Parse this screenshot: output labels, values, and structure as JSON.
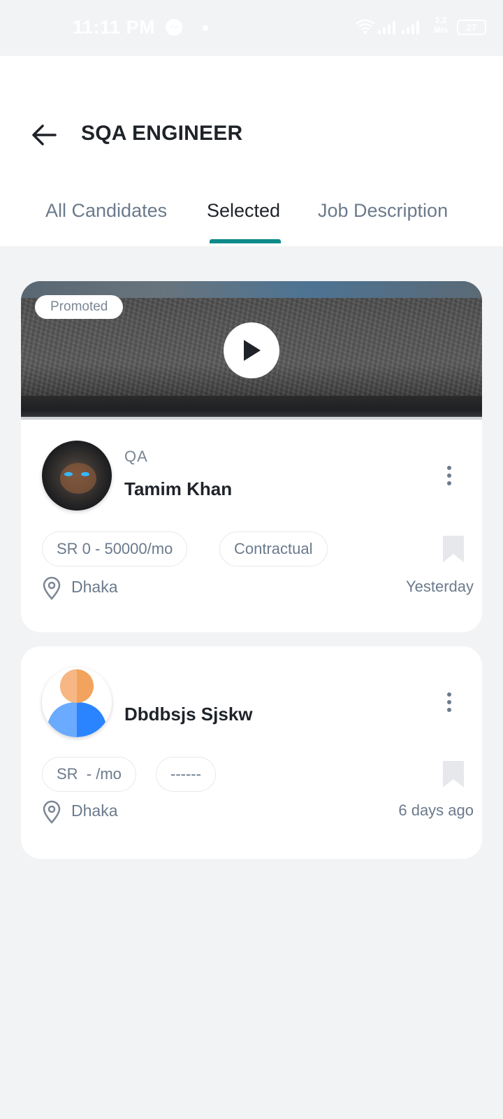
{
  "status_bar": {
    "time": "11:11 PM",
    "speed_top": "2.2",
    "speed_unit": "M/s",
    "battery": "27"
  },
  "header": {
    "title": "SQA ENGINEER"
  },
  "tabs": [
    {
      "label": "All Candidates",
      "active": false
    },
    {
      "label": "Selected",
      "active": true
    },
    {
      "label": "Job Description",
      "active": false
    }
  ],
  "colors": {
    "accent": "#0f8a8a",
    "background": "#f2f3f5",
    "text_primary": "#1f2329",
    "text_secondary": "#6b7a8c"
  },
  "candidates": [
    {
      "promoted_label": "Promoted",
      "role": "QA",
      "name": "Tamim Khan",
      "salary": "SR 0 - 50000/mo",
      "job_type": "Contractual",
      "location": "Dhaka",
      "posted": "Yesterday"
    },
    {
      "name": "Dbdbsjs Sjskw",
      "salary": "SR  - /mo",
      "job_type": "------",
      "location": "Dhaka",
      "posted": "6 days ago"
    }
  ]
}
